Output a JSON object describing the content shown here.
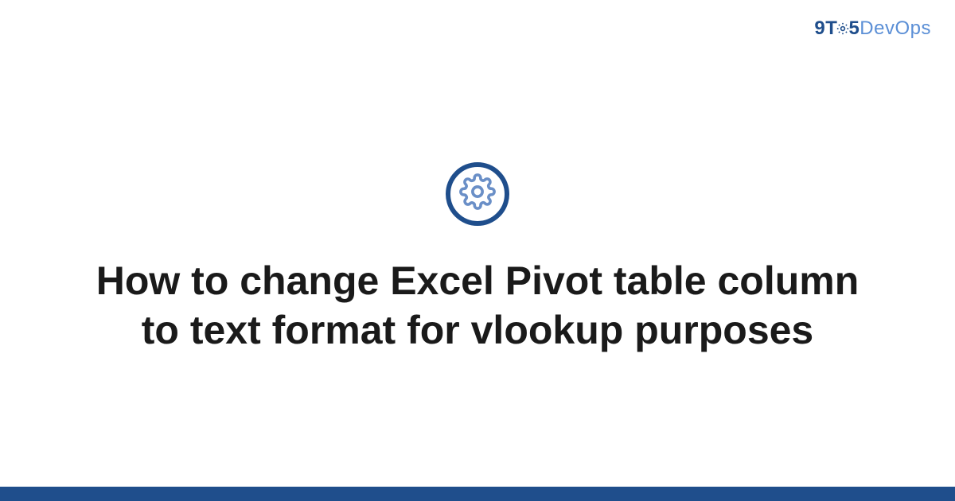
{
  "brand": {
    "prefix": "9T",
    "middle": "5",
    "suffix": "DevOps"
  },
  "main": {
    "title": "How to change Excel Pivot table column to text format for vlookup purposes"
  },
  "colors": {
    "primary": "#1f4e8c",
    "accent": "#5b8fd6"
  }
}
